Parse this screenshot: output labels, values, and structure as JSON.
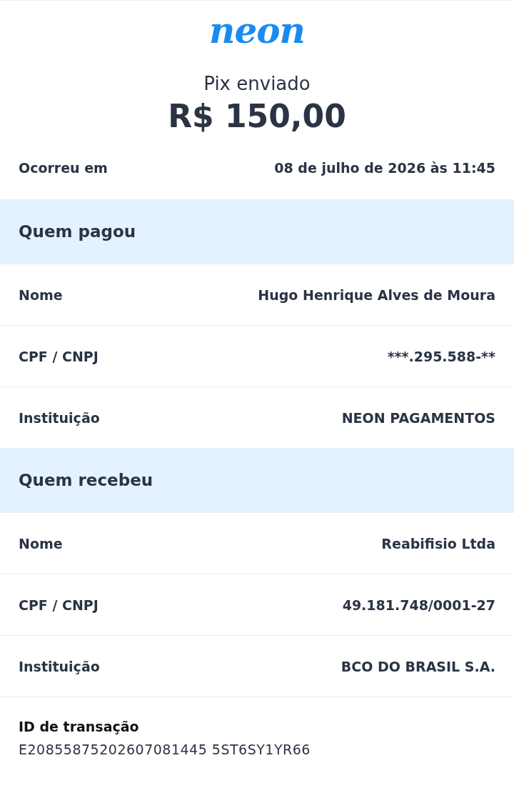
{
  "logo": "neon",
  "title": "Pix enviado",
  "amount": "R$ 150,00",
  "occurred": {
    "label": "Ocorreu em",
    "value": "08 de julho de 2026 às 11:45"
  },
  "sections": [
    {
      "title": "Quem pagou",
      "rows": [
        {
          "label": "Nome",
          "value": "Hugo Henrique Alves de Moura"
        },
        {
          "label": "CPF / CNPJ",
          "value": "***.295.588-**"
        },
        {
          "label": "Instituição",
          "value": "NEON PAGAMENTOS"
        }
      ]
    },
    {
      "title": "Quem recebeu",
      "rows": [
        {
          "label": "Nome",
          "value": "Reabifisio Ltda"
        },
        {
          "label": "CPF / CNPJ",
          "value": "49.181.748/0001-27"
        },
        {
          "label": "Instituição",
          "value": "BCO DO BRASIL S.A."
        }
      ]
    }
  ],
  "transaction": {
    "label": "ID de transação",
    "value": "E20855875202607081445 5ST6SY1YR66"
  }
}
